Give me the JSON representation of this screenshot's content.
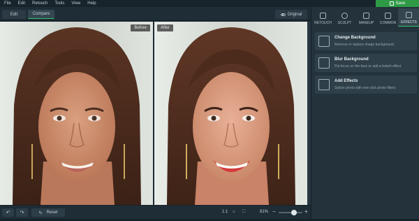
{
  "menu": [
    "File",
    "Edit",
    "Retouch",
    "Tools",
    "View",
    "Help"
  ],
  "save_label": "Save",
  "view_tabs": {
    "edit": "Edit",
    "compare": "Compare",
    "original": "Original"
  },
  "panels": {
    "before": "Before",
    "after": "After"
  },
  "bottom": {
    "undo": "↶",
    "redo": "↷",
    "reset": "Reset",
    "one_to_one": "1:1",
    "zoom": "81%",
    "zoom_level": 0.55,
    "minus": "−",
    "plus": "+"
  },
  "right_tabs": [
    {
      "label": "RETOUCH",
      "icon": "retouch-icon"
    },
    {
      "label": "SCULPT",
      "icon": "sculpt-icon"
    },
    {
      "label": "MAKEUP",
      "icon": "makeup-icon"
    },
    {
      "label": "COMMON",
      "icon": "common-icon"
    },
    {
      "label": "EFFECTS",
      "icon": "effects-icon"
    }
  ],
  "effects": [
    {
      "title": "Change Background",
      "desc": "Remove or replace image background",
      "icon": "background-icon"
    },
    {
      "title": "Blur Background",
      "desc": "Put focus on the face or add a bokeh effect",
      "icon": "blur-icon"
    },
    {
      "title": "Add Effects",
      "desc": "Stylize photo with one-click photo filters",
      "icon": "magic-wand-icon"
    }
  ],
  "colors": {
    "accent": "#35c36a",
    "save": "#2f9a46",
    "bg": "#1c2a33"
  }
}
